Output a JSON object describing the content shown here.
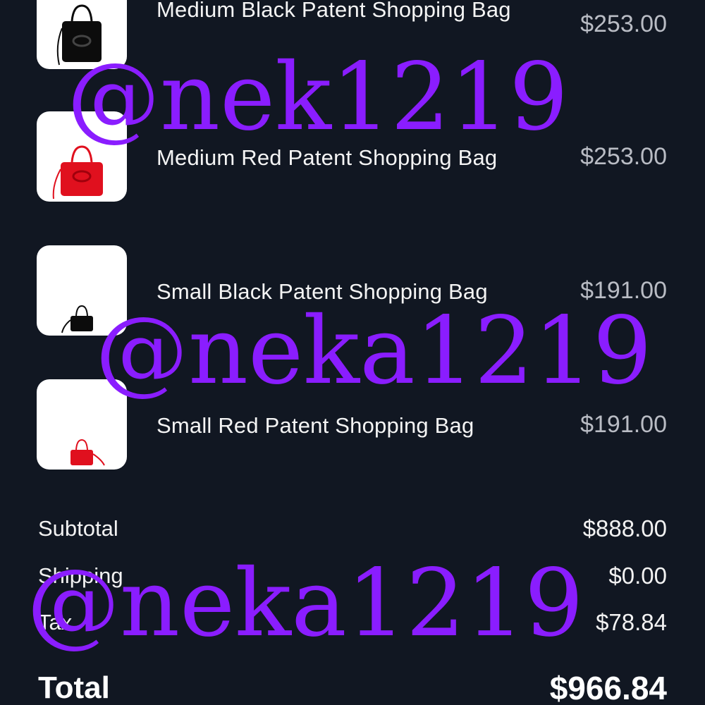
{
  "cart": {
    "items": [
      {
        "name": "Medium Black Patent Shopping Bag",
        "price": "$253.00",
        "image": "black-medium-bag-image"
      },
      {
        "name": "Medium Red Patent Shopping Bag",
        "price": "$253.00",
        "image": "red-medium-bag-image"
      },
      {
        "name": "Small Black Patent Shopping Bag",
        "price": "$191.00",
        "image": "black-small-bag-image"
      },
      {
        "name": "Small Red Patent Shopping Bag",
        "price": "$191.00",
        "image": "red-small-bag-image"
      }
    ]
  },
  "summary": {
    "subtotal_label": "Subtotal",
    "subtotal_value": "$888.00",
    "shipping_label": "Shipping",
    "shipping_value": "$0.00",
    "tax_label": "Tax",
    "tax_value": "$78.84",
    "total_label": "Total",
    "total_value": "$966.84"
  },
  "watermarks": [
    "@nek1219",
    "@neka1219",
    "@neka1219"
  ],
  "colors": {
    "background": "#111722",
    "watermark": "#8a1dff",
    "price_text": "#b9bcc4",
    "bag_black": "#0c0c0c",
    "bag_red": "#e0101e"
  }
}
